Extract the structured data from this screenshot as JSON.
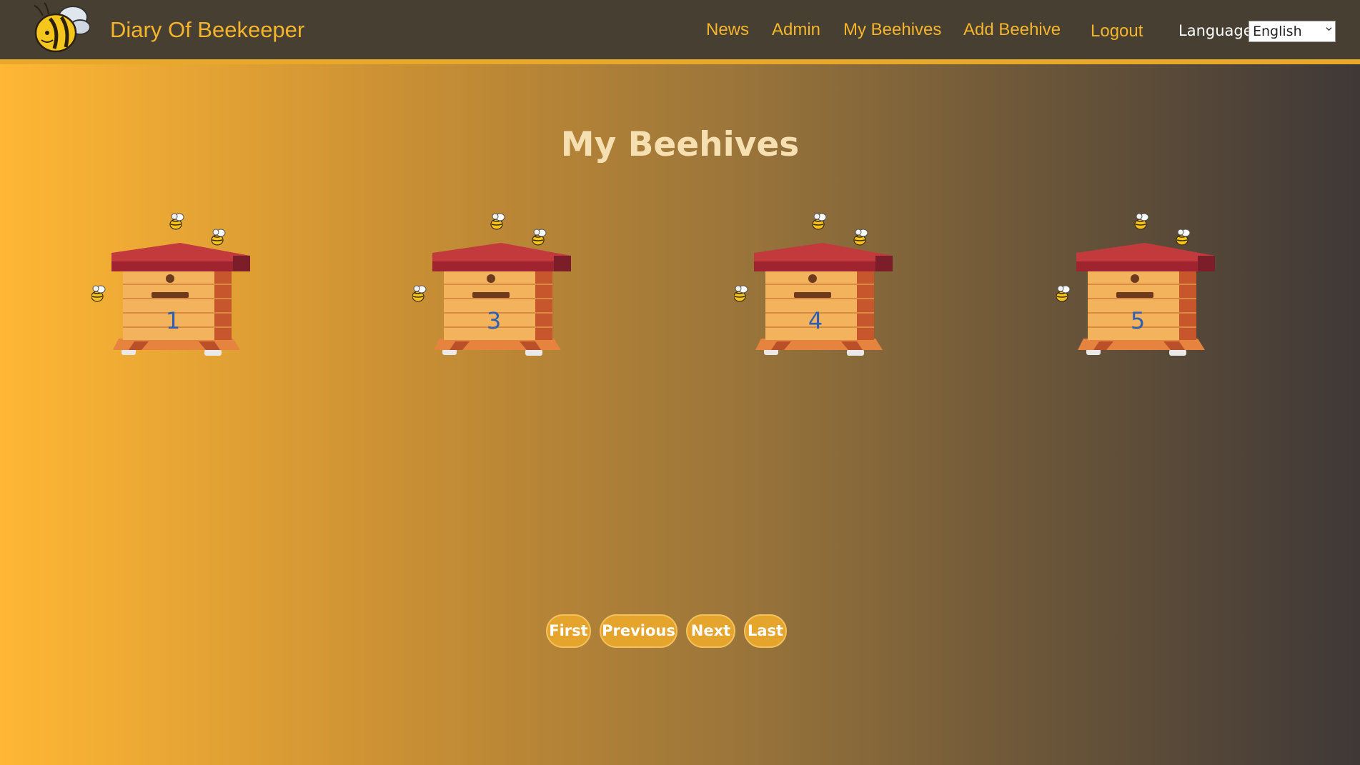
{
  "header": {
    "brand": "Diary Of Beekeeper",
    "nav": {
      "news": "News",
      "admin": "Admin",
      "my_beehives": "My Beehives",
      "add_beehive": "Add Beehive",
      "logout": "Logout"
    },
    "language_label": "Language",
    "language_selected": "English"
  },
  "main": {
    "title": "My Beehives",
    "hives": [
      {
        "number": "1"
      },
      {
        "number": "3"
      },
      {
        "number": "4"
      },
      {
        "number": "5"
      }
    ],
    "pagination": {
      "first": "First",
      "previous": "Previous",
      "next": "Next",
      "last": "Last"
    }
  },
  "colors": {
    "accent": "#f4b52d",
    "navbar_bg": "#473f31",
    "hive_number": "#2f5fb4"
  }
}
